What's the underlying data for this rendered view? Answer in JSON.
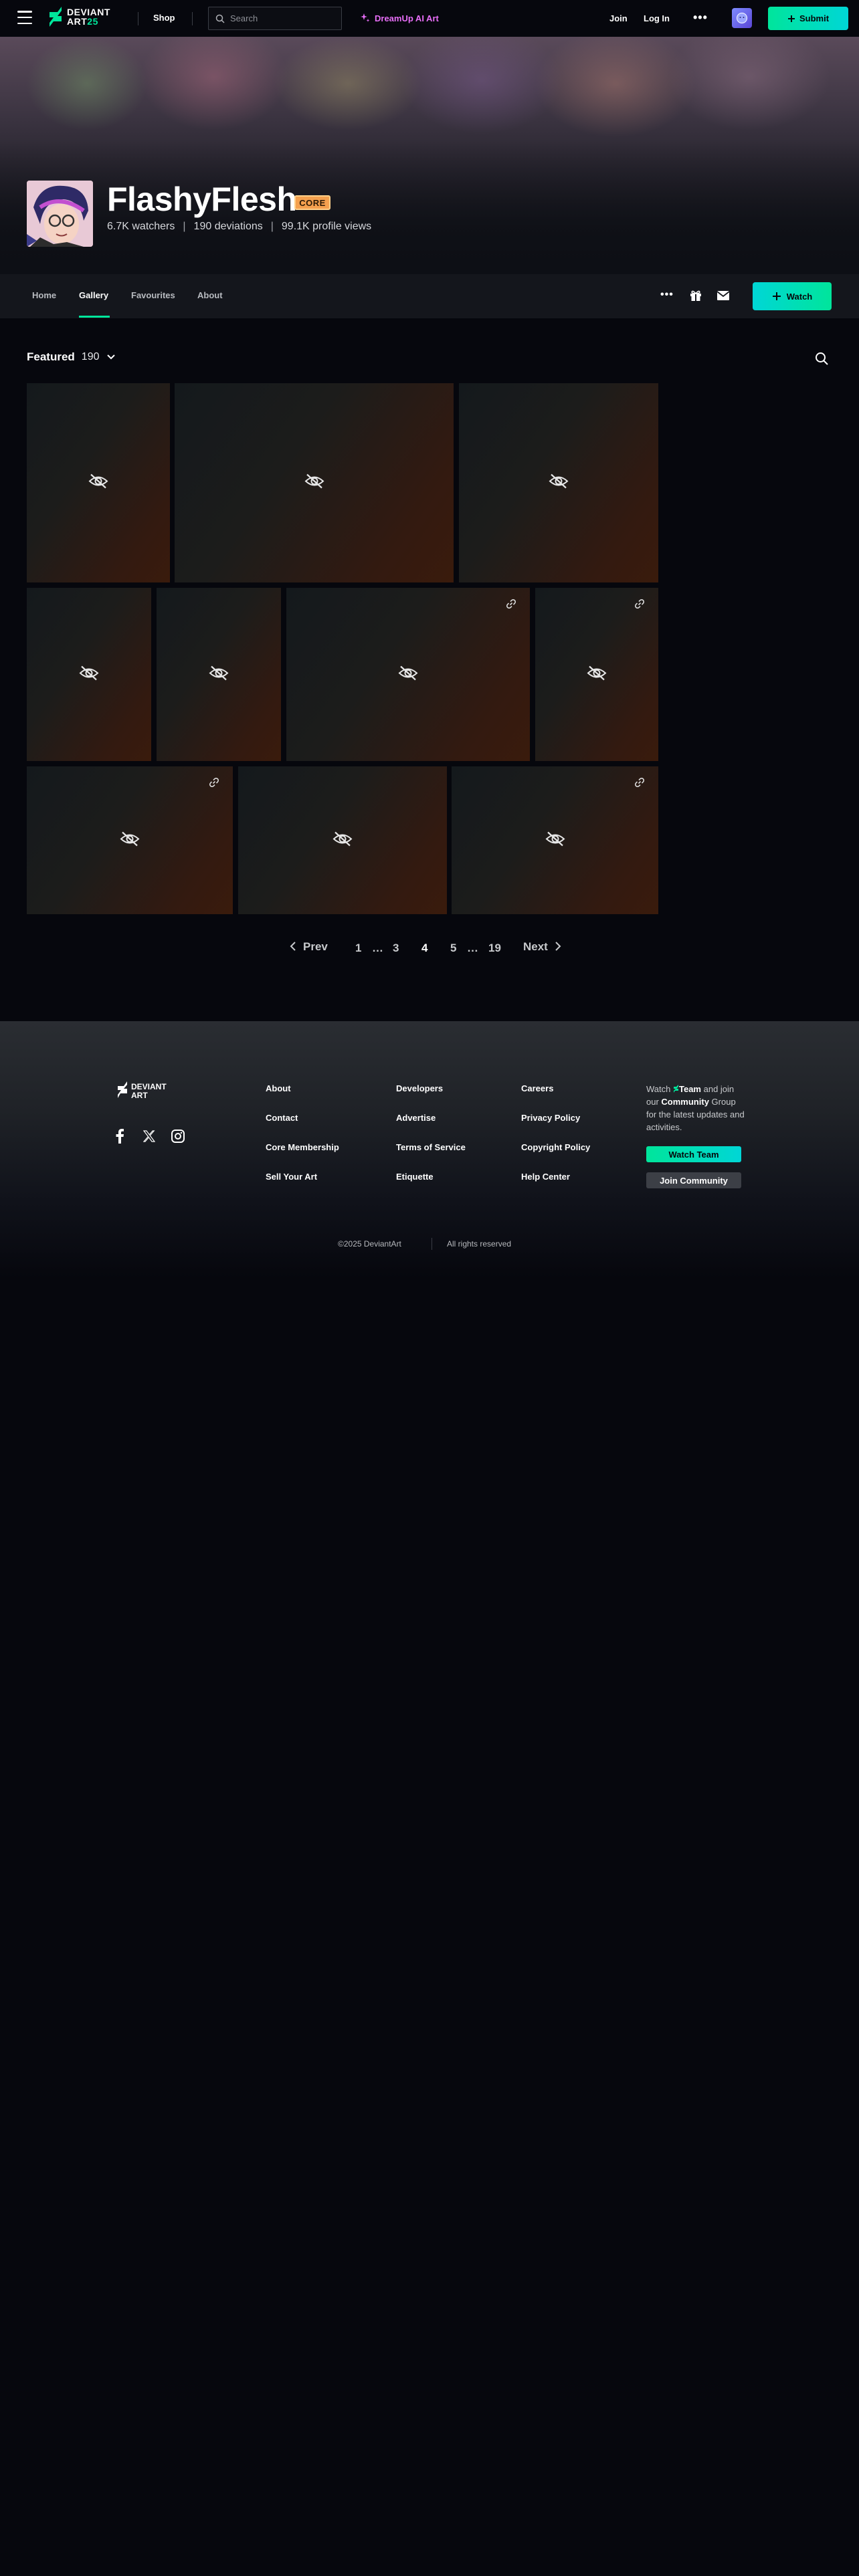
{
  "topnav": {
    "logo_line1": "DEVIANT",
    "logo_line2": "ART",
    "logo_line2_accent": "25",
    "shop": "Shop",
    "search_placeholder": "Search",
    "dreamup": "DreamUp AI Art",
    "join": "Join",
    "login": "Log In",
    "more": "•••",
    "submit": "Submit"
  },
  "profile": {
    "username": "FlashyFlesh",
    "badge": "CORE",
    "watchers": "6.7K watchers",
    "deviations": "190 deviations",
    "views": "99.1K profile views",
    "separator": "|"
  },
  "tabs": [
    {
      "label": "Home"
    },
    {
      "label": "Gallery"
    },
    {
      "label": "Favourites"
    },
    {
      "label": "About"
    }
  ],
  "tab_actions": {
    "more": "•••",
    "watch": "Watch"
  },
  "gallery": {
    "title": "Featured",
    "count": "190"
  },
  "pagination": {
    "prev": "Prev",
    "next": "Next",
    "pages": [
      "1",
      "…",
      "3",
      "4",
      "5",
      "…",
      "19"
    ],
    "current": "4"
  },
  "footer": {
    "columns": [
      [
        "About",
        "Contact",
        "Core Membership",
        "Sell Your Art"
      ],
      [
        "Developers",
        "Advertise",
        "Terms of Service",
        "Etiquette"
      ],
      [
        "Careers",
        "Privacy Policy",
        "Copyright Policy",
        "Help Center"
      ]
    ],
    "watch_prefix": "Watch",
    "team_word": "Team",
    "watch_mid": "and join our",
    "community_word": "Community",
    "watch_suffix": "Group for the latest updates and activities.",
    "watch_team_button": "Watch Team",
    "join_community_button": "Join Community",
    "copyright": "©2025 DeviantArt",
    "rights": "All rights reserved"
  },
  "colors": {
    "accent_green": "#00e59b",
    "core_badge": "#f4a04e",
    "dreamup_purple": "#e76ef7",
    "background": "#06070d"
  }
}
